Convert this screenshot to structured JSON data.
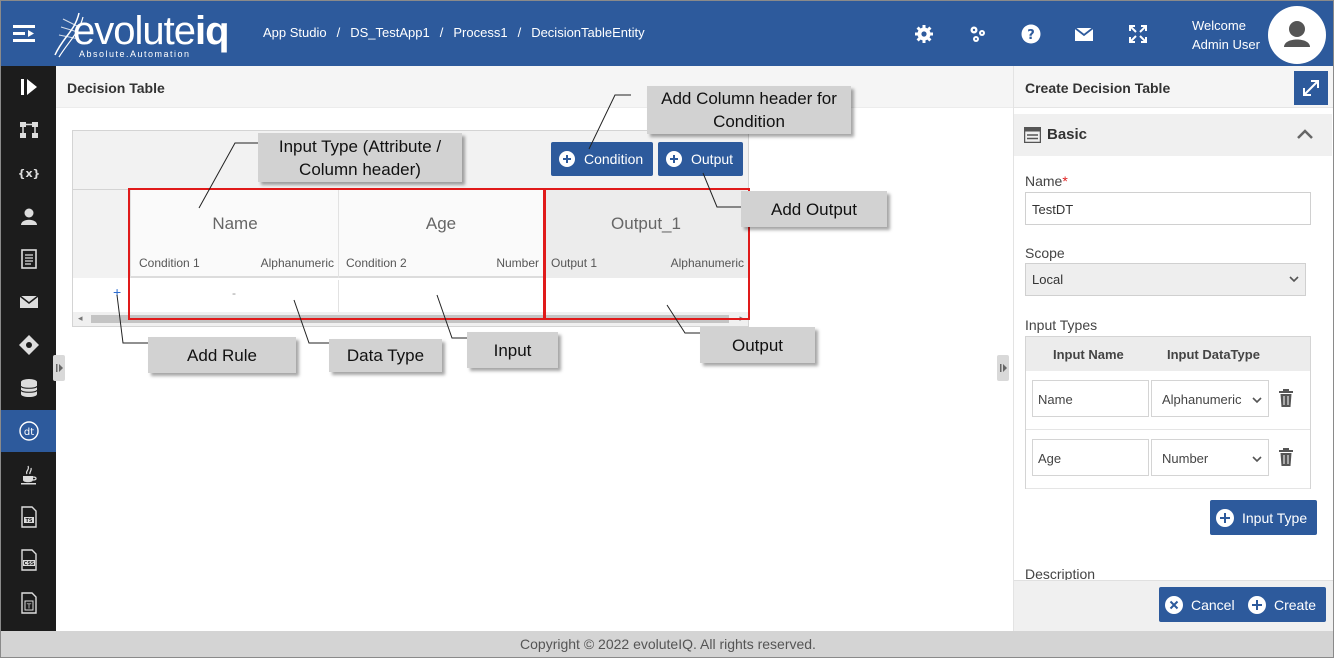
{
  "header": {
    "logo_text": "evolute",
    "logo_text_bold": "iq",
    "logo_tagline": "Absolute.Automation",
    "breadcrumb": [
      "App Studio",
      "DS_TestApp1",
      "Process1",
      "DecisionTableEntity"
    ],
    "breadcrumb_sep": "/",
    "welcome_line1": "Welcome",
    "welcome_line2": "Admin User",
    "icons": [
      "settings-icon",
      "apps-icon",
      "help-icon",
      "mail-icon",
      "fullscreen-icon",
      "user-avatar"
    ]
  },
  "sidebar": {
    "items": [
      "expand-panel",
      "process-flow",
      "variables",
      "user",
      "document",
      "mail",
      "rules",
      "database",
      "decision-table",
      "java",
      "typescript",
      "css",
      "text-file"
    ],
    "active": "decision-table"
  },
  "main": {
    "title": "Decision Table",
    "condition_button": "Condition",
    "output_button": "Output",
    "columns": [
      {
        "name": "Name",
        "sub": "Condition 1",
        "type": "Alphanumeric",
        "kind": "input"
      },
      {
        "name": "Age",
        "sub": "Condition 2",
        "type": "Number",
        "kind": "input"
      },
      {
        "name": "Output_1",
        "sub": "Output 1",
        "type": "Alphanumeric",
        "kind": "output"
      }
    ],
    "row_add_symbol": "+",
    "row_placeholder": "-"
  },
  "callouts": {
    "add_column": "Add Column header for Condition",
    "input_type": "Input Type (Attribute / Column header)",
    "add_output": "Add Output",
    "add_rule": "Add Rule",
    "data_type": "Data Type",
    "input": "Input",
    "output": "Output"
  },
  "panel": {
    "title": "Create Decision Table",
    "section": "Basic",
    "name_label": "Name",
    "required_mark": "*",
    "name_value": "TestDT",
    "scope_label": "Scope",
    "scope_value": "Local",
    "input_types_label": "Input Types",
    "col_input_name": "Input Name",
    "col_input_datatype": "Input DataType",
    "input_types": [
      {
        "name": "Name",
        "type": "Alphanumeric"
      },
      {
        "name": "Age",
        "type": "Number"
      }
    ],
    "add_input_type_button": "Input Type",
    "description_label": "Description",
    "cancel_button": "Cancel",
    "create_button": "Create"
  },
  "footer": {
    "copyright": "Copyright © 2022 evoluteIQ. All rights reserved."
  },
  "colors": {
    "brand": "#2d5a9c",
    "sidebar": "#1c1c1c",
    "highlight": "#e01a1a",
    "callout": "#d2d2d2"
  }
}
